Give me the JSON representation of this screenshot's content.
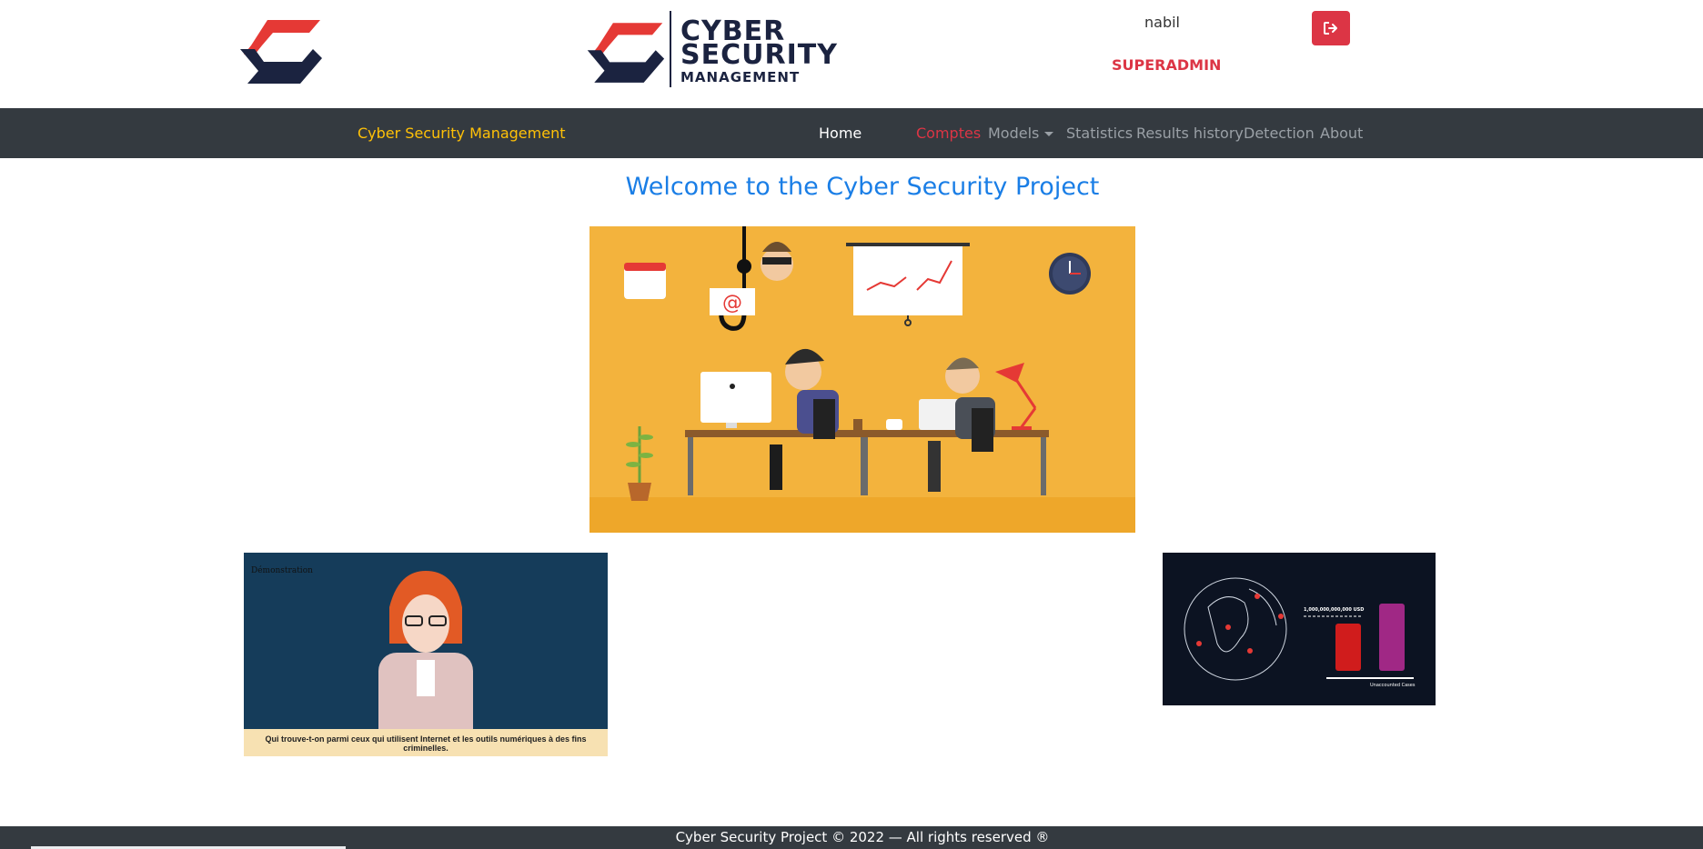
{
  "header": {
    "brand_line1": "CYBER",
    "brand_line2": "SECURITY",
    "brand_line3": "MANAGEMENT",
    "username": "nabil",
    "role": "SUPERADMIN",
    "logout_icon": "sign-out-icon"
  },
  "navbar": {
    "brand": "Cyber Security Management",
    "items": [
      {
        "label": "Home"
      },
      {
        "label": "Comptes"
      },
      {
        "label": "Models"
      },
      {
        "label": "Statistics"
      },
      {
        "label": "Results history"
      },
      {
        "label": "Detection"
      },
      {
        "label": "About"
      }
    ]
  },
  "main": {
    "title": "Welcome to the Cyber Security Project",
    "video_left": {
      "header": "Démonstration",
      "caption": "Qui trouve-t-on parmi ceux qui utilisent Internet et les outils numériques à des fins criminelles."
    },
    "video_right": {
      "amount_label": "1,000,000,000,000 USD",
      "bar_label": "Unaccounted Cases"
    }
  },
  "footer": {
    "text": "Cyber Security Project © 2022 — All rights reserved ®"
  },
  "colors": {
    "navbar_bg": "#343a40",
    "brand_yellow": "#ffc107",
    "danger_red": "#dc3545",
    "primary_blue": "#1a7ee6",
    "logo_navy": "#1b2340"
  }
}
